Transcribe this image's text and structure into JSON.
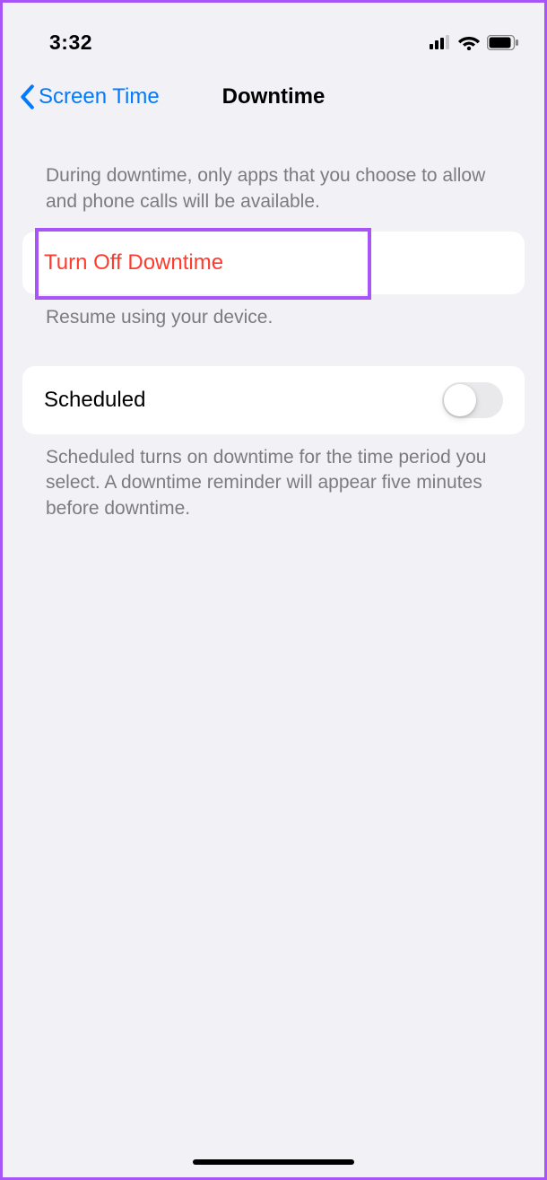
{
  "status": {
    "time": "3:32"
  },
  "nav": {
    "back_label": "Screen Time",
    "title": "Downtime"
  },
  "section1": {
    "header": "During downtime, only apps that you choose to allow and phone calls will be available.",
    "row_label": "Turn Off Downtime",
    "footer": "Resume using your device."
  },
  "section2": {
    "row_label": "Scheduled",
    "toggle_on": false,
    "footer": "Scheduled turns on downtime for the time period you select. A downtime reminder will appear five minutes before downtime."
  }
}
